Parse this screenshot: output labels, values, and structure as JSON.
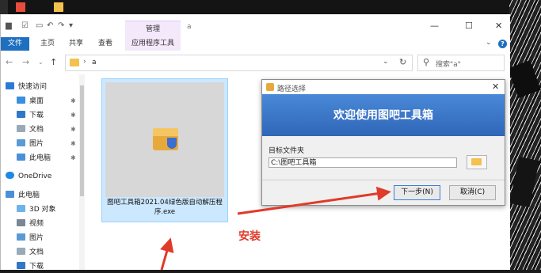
{
  "window": {
    "manage_tab": "管理",
    "title": "a",
    "ribbon_tabs": [
      "文件",
      "主页",
      "共享",
      "查看",
      "应用程序工具"
    ]
  },
  "address": {
    "path": "a",
    "search_placeholder": "搜索\"a\""
  },
  "nav_pane": {
    "quick_access": "快速访问",
    "quick_items": [
      "桌面",
      "下载",
      "文档",
      "图片",
      "此电脑"
    ],
    "onedrive": "OneDrive",
    "this_pc": "此电脑",
    "pc_items": [
      "3D 对象",
      "视频",
      "图片",
      "文档",
      "下载"
    ]
  },
  "file": {
    "name": "图吧工具箱2021.04绿色版自动解压程序.exe"
  },
  "dialog": {
    "title": "路径选择",
    "banner": "欢迎使用图吧工具箱",
    "target_label": "目标文件夹",
    "path_value": "C:\\图吧工具箱",
    "next_button": "下一步(N)",
    "cancel_button": "取消(C)"
  },
  "annotation": {
    "text": "安装",
    "color": "#e03a2a"
  },
  "colors": {
    "accent": "#1f6fc1",
    "banner": "#3a78c8",
    "manage_tab_bg": "#f4e8fb"
  }
}
